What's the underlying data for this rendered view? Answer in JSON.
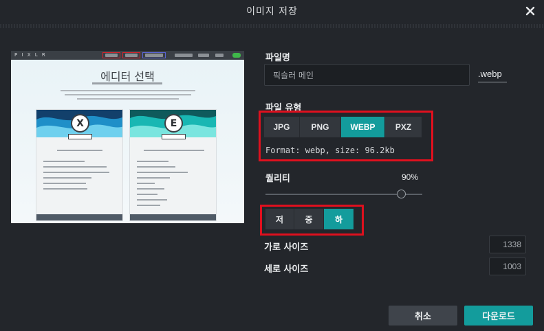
{
  "dialog": {
    "title": "이미지 저장",
    "close_icon": "close-icon"
  },
  "preview": {
    "logo": "P I X L R",
    "heading": "에디터 선택",
    "card_x_letter": "X",
    "card_e_letter": "E"
  },
  "filename": {
    "label": "파일명",
    "value": "픽슬러 메인",
    "extension": ".webp"
  },
  "file_type": {
    "label": "파일 유형",
    "options": [
      "JPG",
      "PNG",
      "WEBP",
      "PXZ"
    ],
    "selected": "WEBP",
    "info": "Format: webp, size: 96.2kb"
  },
  "quality": {
    "label": "퀄리티",
    "value_text": "90%",
    "value": 90,
    "levels": [
      "저",
      "중",
      "하"
    ],
    "selected_level": "하"
  },
  "size": {
    "width_label": "가로 사이즈",
    "width_value": "1338",
    "height_label": "세로 사이즈",
    "height_value": "1003"
  },
  "actions": {
    "cancel": "취소",
    "download": "다운로드"
  },
  "colors": {
    "background": "#23262b",
    "accent": "#139c9c",
    "highlight_box": "#e0101e"
  }
}
